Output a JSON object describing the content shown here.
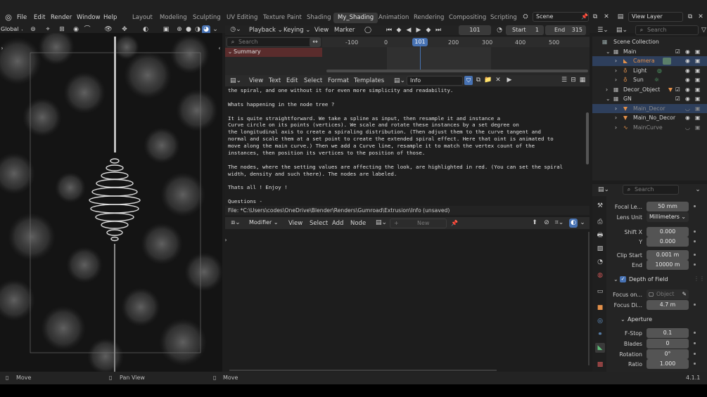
{
  "menubar": {
    "items": [
      "File",
      "Edit",
      "Render",
      "Window",
      "Help"
    ]
  },
  "workspaces": [
    "Layout",
    "Modeling",
    "Sculpting",
    "UV Editing",
    "Texture Paint",
    "Shading",
    "My_Shading",
    "Animation",
    "Rendering",
    "Compositing",
    "Scripting"
  ],
  "active_workspace": "My_Shading",
  "scene": {
    "name": "Scene"
  },
  "view_layer": {
    "name": "View Layer"
  },
  "viewport": {
    "transform_orientation": "Global"
  },
  "timeline": {
    "menus": [
      "Playback",
      "Keying",
      "View",
      "Marker"
    ],
    "current_frame": "101",
    "start_label": "Start",
    "start_value": "1",
    "end_label": "End",
    "end_value": "315",
    "search_placeholder": "Search",
    "summary_label": "Summary",
    "ruler_ticks": [
      "-100",
      "0",
      "101",
      "200",
      "300",
      "400",
      "500"
    ]
  },
  "text_editor": {
    "menus": [
      "View",
      "Text",
      "Edit",
      "Select",
      "Format",
      "Templates"
    ],
    "datablock_name": "Info",
    "lines": [
      "the spiral, and one without it for even more simplicity and readability.",
      "",
      "Whats happening in the node tree ?",
      "",
      "It is quite straightforward. We take a spline as input, then resample it and instance a",
      "Curve circle on its points (vertices). We scale and rotate these instances by a set degree on",
      "the longitudinal axis to create a spiraling distribution. (Then adjust them to the curve tangent and",
      "normal and scale them at a set point to create the extended spiral effect. Here that oint is animated to",
      "move along the main curve.) Then we add a Curve line, resample it to match the vertex count of the",
      "instances, then position its vertices to the position of those.",
      "",
      "The nodes, where the setting values are affecting the look, are highlighted in red. (You can set the spiral",
      "width, density and such there). The nodes are labeled.",
      "",
      "Thats all ! Enjoy !",
      "",
      "Questions -"
    ],
    "footer": "File: *C:\\Users\\codes\\OneDrive\\Blender\\Renders\\Gumroad\\Extrusion\\Info (unsaved)"
  },
  "node_editor": {
    "mode": "Modifier",
    "menus": [
      "View",
      "Select",
      "Add",
      "Node"
    ],
    "new_label": "New"
  },
  "outliner": {
    "search_placeholder": "Search",
    "rows": [
      {
        "label": "Scene Collection"
      },
      {
        "label": "Main"
      },
      {
        "label": "Camera"
      },
      {
        "label": "Light"
      },
      {
        "label": "Sun"
      },
      {
        "label": "Decor_Object"
      },
      {
        "label": "GN"
      },
      {
        "label": "Main_Decor"
      },
      {
        "label": "Main_No_Decor"
      },
      {
        "label": "MainCurve"
      }
    ]
  },
  "properties": {
    "search_placeholder": "Search",
    "fields": [
      {
        "label": "Focal Le...",
        "value": "50 mm"
      },
      {
        "label": "Lens Unit",
        "value": "Millimeters"
      },
      {
        "label": "Shift X",
        "value": "0.000"
      },
      {
        "label": "Y",
        "value": "0.000"
      },
      {
        "label": "Clip Start",
        "value": "0.001 m"
      },
      {
        "label": "End",
        "value": "10000 m"
      }
    ],
    "dof_label": "Depth of Field",
    "focus_on_label": "Focus on...",
    "focus_on_value": "Object",
    "focus_distance": {
      "label": "Focus Di...",
      "value": "4.7 m"
    },
    "aperture_label": "Aperture",
    "aperture_fields": [
      {
        "label": "F-Stop",
        "value": "0.1"
      },
      {
        "label": "Blades",
        "value": "0"
      },
      {
        "label": "Rotation",
        "value": "0°"
      },
      {
        "label": "Ratio",
        "value": "1.000"
      }
    ]
  },
  "statusbar": {
    "items": [
      "Move",
      "Pan View",
      "Move"
    ],
    "version": "4.1.1"
  },
  "colors": {
    "accent_blue": "#4772b3",
    "selected_row": "#2e3f5c",
    "camera_orange": "#e3904a",
    "summary_red": "#5a2c2c"
  }
}
